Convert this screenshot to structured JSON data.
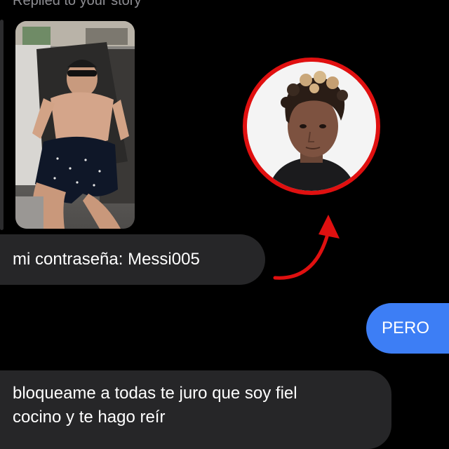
{
  "story_reply": {
    "label": "Replied to your story",
    "photo": "story-photo-man-sunglasses-lounging"
  },
  "messages": [
    {
      "direction": "incoming",
      "text": "mi contraseña: Messi005"
    },
    {
      "direction": "outgoing",
      "text": "PERO"
    },
    {
      "direction": "incoming",
      "lines": [
        "bloqueame a todas te juro que soy fiel",
        "cocino y te hago reír"
      ]
    }
  ],
  "annotation": {
    "circle_color": "#e01010",
    "arrow_color": "#e01010",
    "photo": "young-man-curly-hair-portrait"
  },
  "colors": {
    "background": "#000000",
    "incoming_bubble": "#262628",
    "outgoing_bubble": "#3d7ef5",
    "muted_text": "#8e8e93"
  }
}
